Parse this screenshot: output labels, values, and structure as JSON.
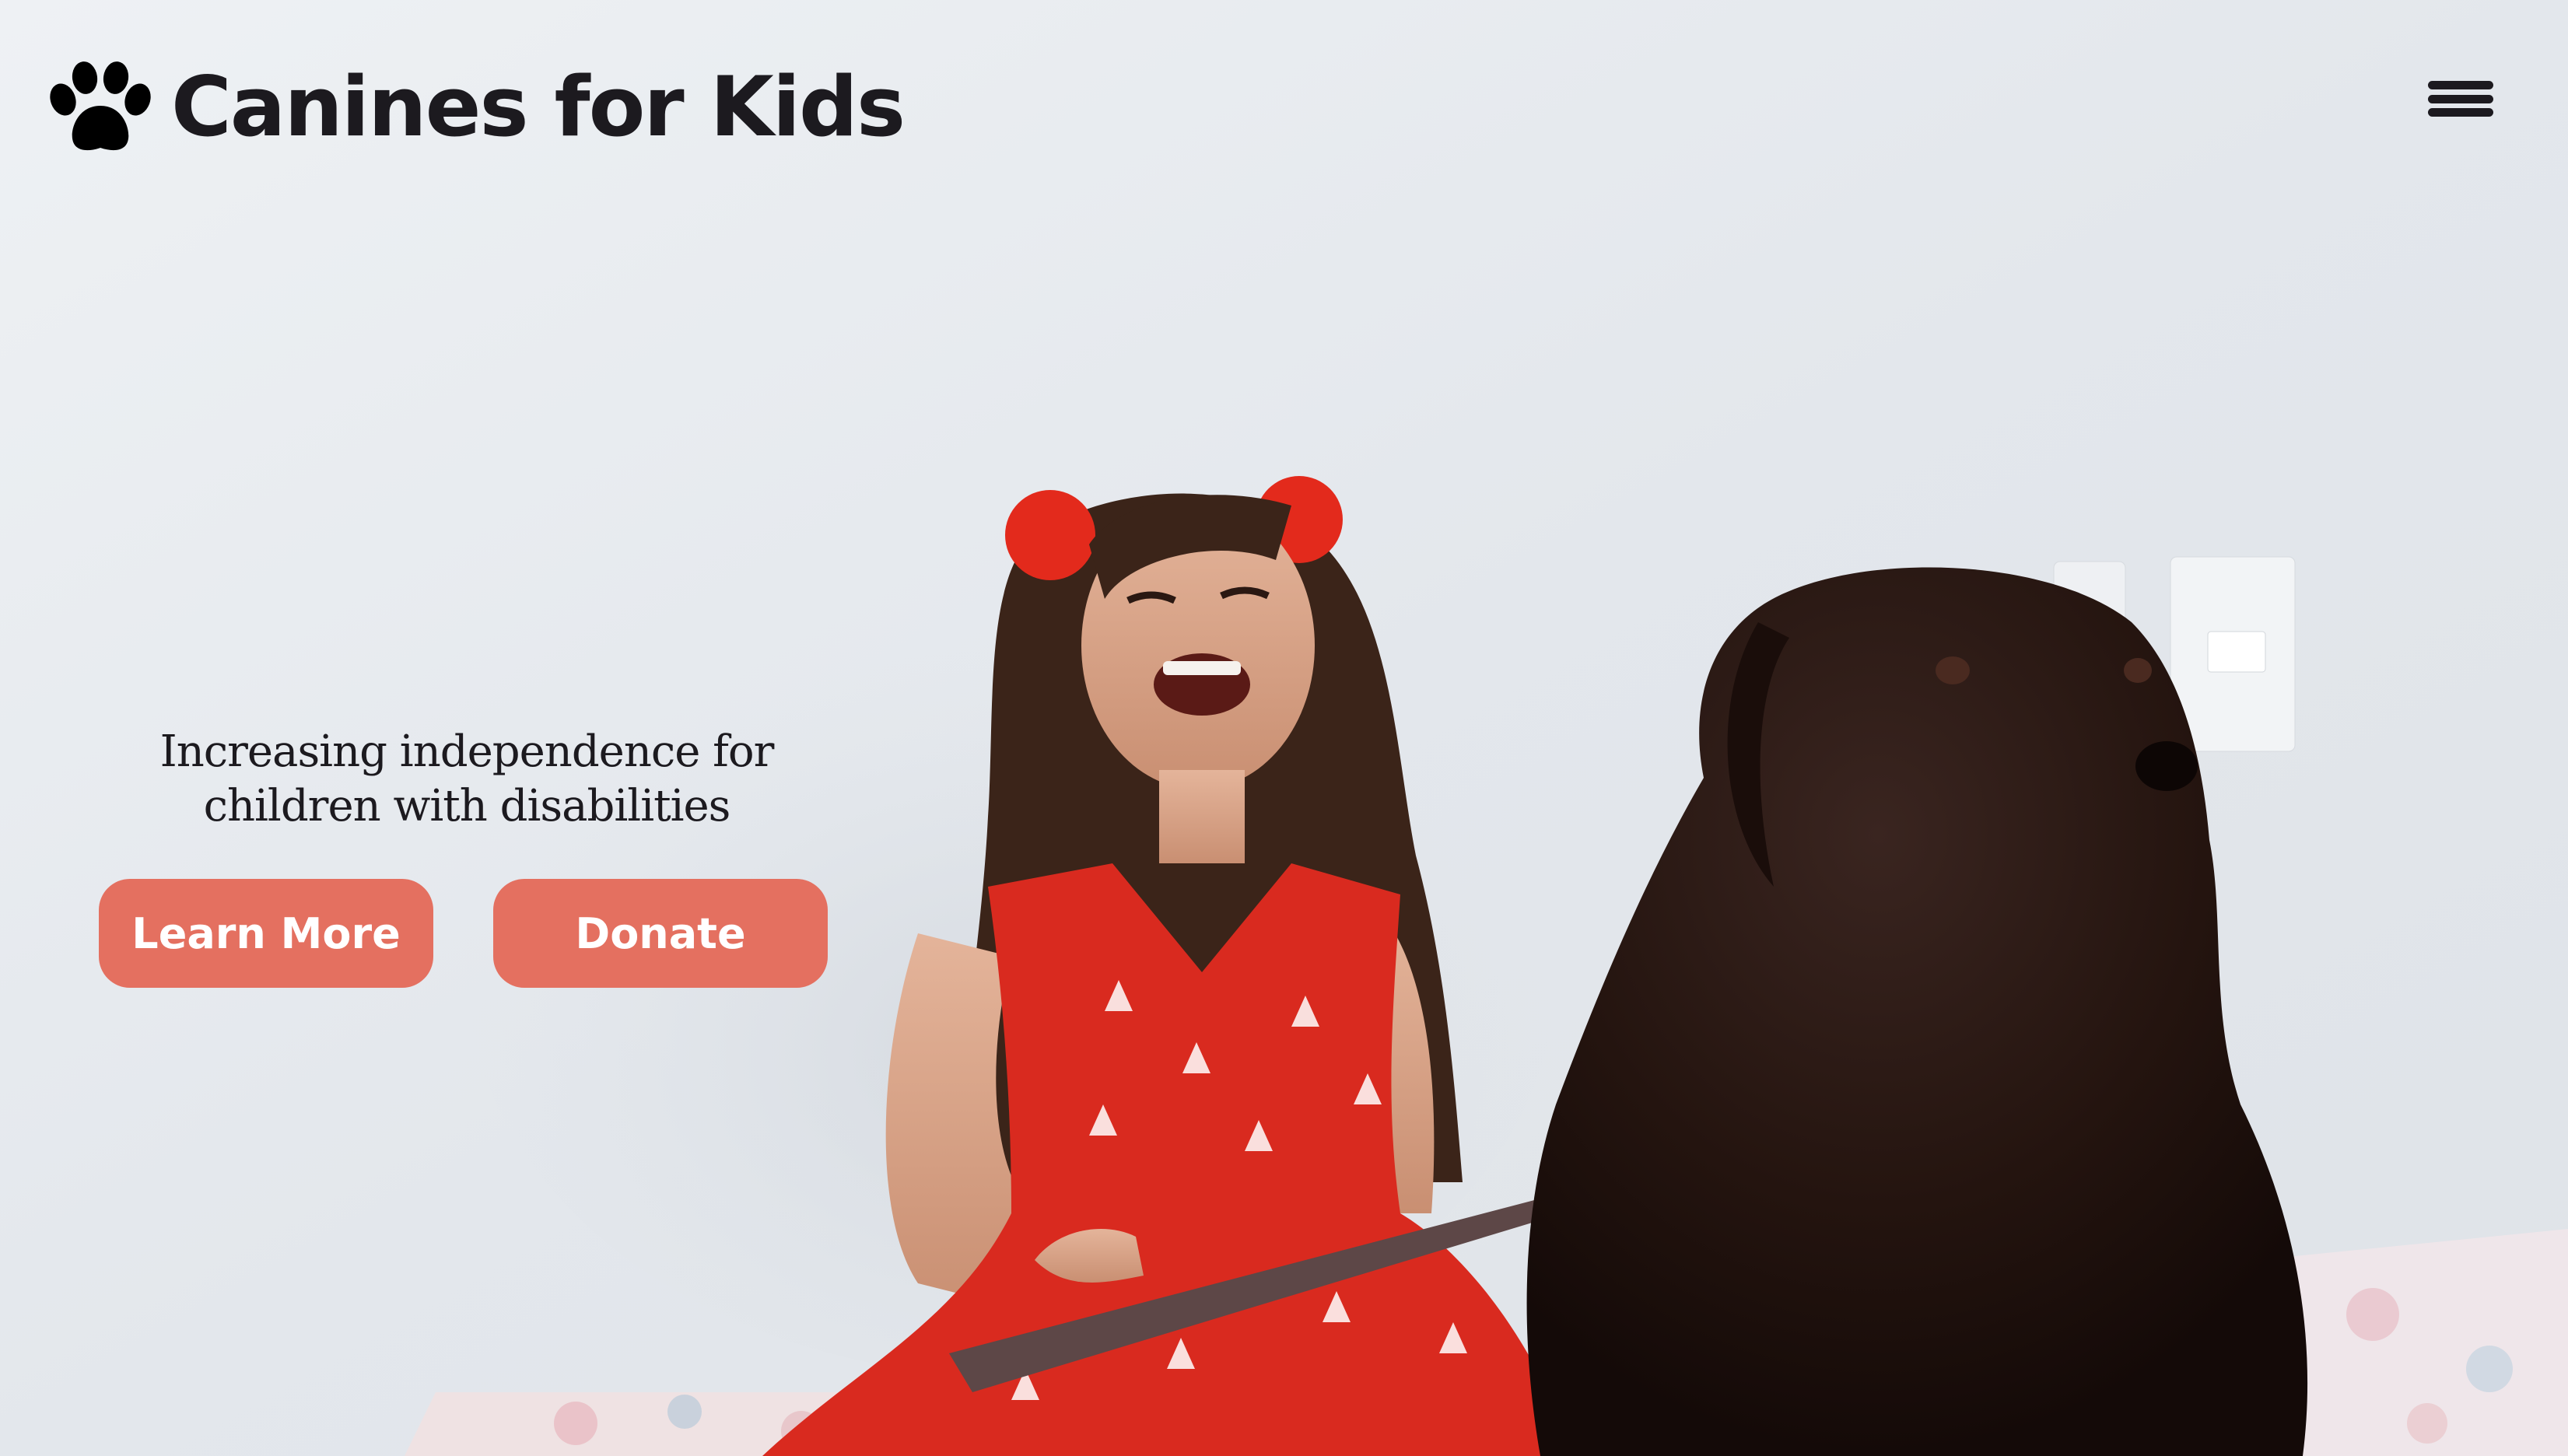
{
  "header": {
    "brand_name": "Canines for Kids",
    "logo_icon": "paw-print-icon",
    "menu_icon": "hamburger-menu-icon"
  },
  "hero": {
    "tagline_line1": "Increasing independence for",
    "tagline_line2": "children with disabilities",
    "learn_more_label": "Learn More",
    "donate_label": "Donate",
    "image_subject": "smiling girl in red dress holding a tablet next to a dark brown dog"
  },
  "colors": {
    "accent": "#e47060",
    "text": "#1c1a1f",
    "background": "#e6eaef"
  }
}
